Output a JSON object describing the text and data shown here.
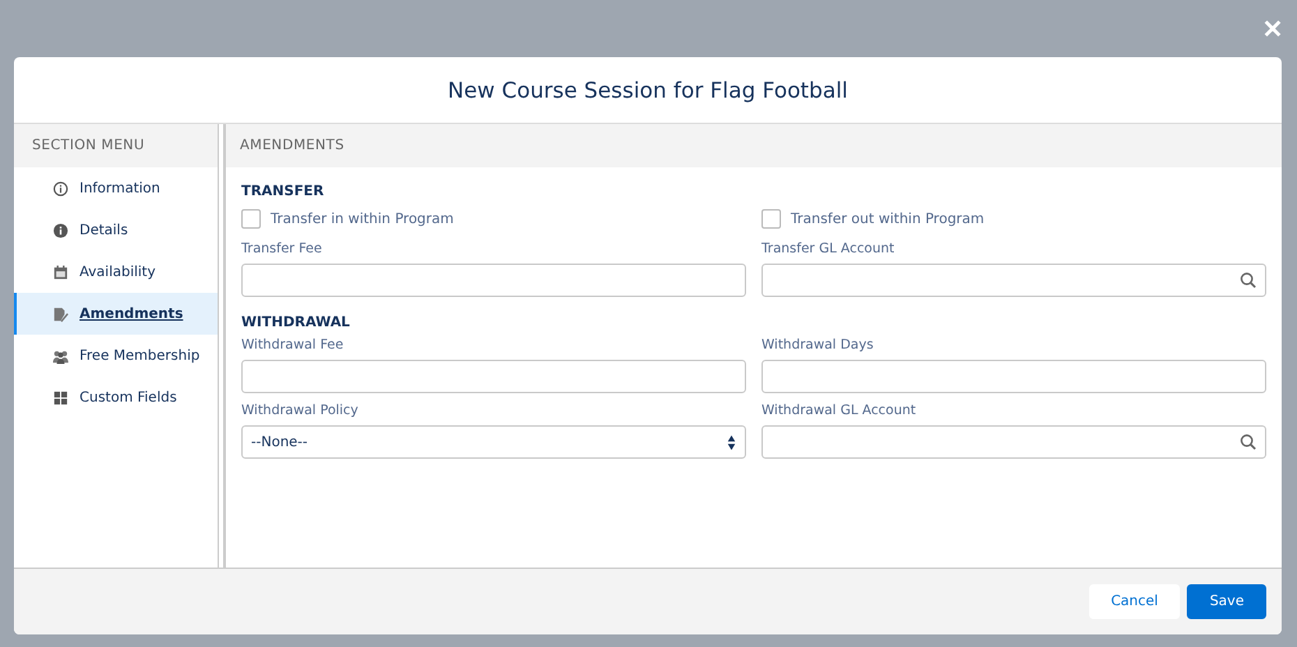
{
  "close": "✕",
  "dialog": {
    "title": "New Course Session for Flag Football"
  },
  "sidebar": {
    "heading": "SECTION MENU",
    "items": [
      {
        "label": "Information",
        "selected": false
      },
      {
        "label": "Details",
        "selected": false
      },
      {
        "label": "Availability",
        "selected": false
      },
      {
        "label": "Amendments",
        "selected": true
      },
      {
        "label": "Free Membership",
        "selected": false
      },
      {
        "label": "Custom Fields",
        "selected": false
      }
    ]
  },
  "content": {
    "heading": "AMENDMENTS",
    "sections": [
      {
        "title": "TRANSFER",
        "checkboxes": [
          {
            "label": "Transfer in within Program",
            "checked": false
          },
          {
            "label": "Transfer out within Program",
            "checked": false
          }
        ],
        "fields": [
          {
            "kind": "text",
            "label": "Transfer Fee"
          },
          {
            "kind": "lookup",
            "label": "Transfer GL Account"
          }
        ]
      },
      {
        "title": "WITHDRAWAL",
        "fields": [
          {
            "kind": "text",
            "label": "Withdrawal Fee"
          },
          {
            "kind": "text",
            "label": "Withdrawal Days"
          },
          {
            "kind": "select",
            "label": "Withdrawal Policy",
            "value": "--None--"
          },
          {
            "kind": "lookup",
            "label": "Withdrawal GL Account"
          }
        ]
      }
    ]
  },
  "footer": {
    "buttons": [
      {
        "label": "Cancel",
        "kind": "neutral"
      },
      {
        "label": "Save",
        "kind": "brand"
      }
    ]
  }
}
